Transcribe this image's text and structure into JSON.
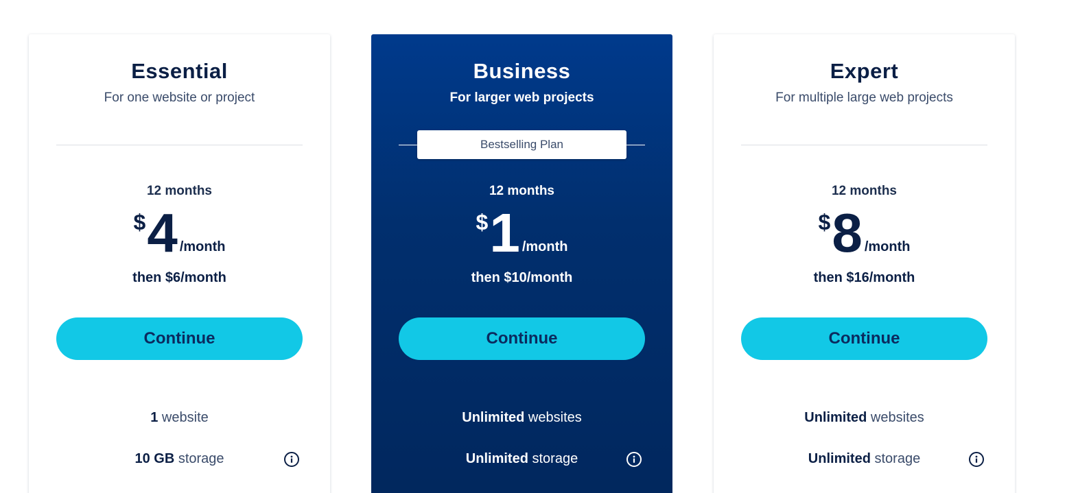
{
  "plans": [
    {
      "name": "Essential",
      "subtitle": "For one website or project",
      "term": "12 months",
      "currency": "$",
      "price": "4",
      "per": "/month",
      "then": "then $6/month",
      "cta": "Continue",
      "feature1": {
        "bold": "1",
        "rest": " website"
      },
      "feature2": {
        "bold": "10 GB",
        "rest": " storage"
      }
    },
    {
      "name": "Business",
      "subtitle": "For larger web projects",
      "badge": "Bestselling Plan",
      "term": "12 months",
      "currency": "$",
      "price": "1",
      "per": "/month",
      "then": "then $10/month",
      "cta": "Continue",
      "feature1": {
        "bold": "Unlimited",
        "rest": " websites"
      },
      "feature2": {
        "bold": "Unlimited",
        "rest": " storage"
      }
    },
    {
      "name": "Expert",
      "subtitle": "For multiple large web projects",
      "term": "12 months",
      "currency": "$",
      "price": "8",
      "per": "/month",
      "then": "then $16/month",
      "cta": "Continue",
      "feature1": {
        "bold": "Unlimited",
        "rest": " websites"
      },
      "feature2": {
        "bold": "Unlimited",
        "rest": " storage"
      }
    }
  ],
  "colors": {
    "navy_text": "#0b1f45",
    "business_card_top": "#003a8c",
    "business_card_bottom": "#01275d",
    "cta_background": "#12c8e6",
    "cta_text": "#0b2a5e"
  },
  "icons": {
    "info": "info-circle-icon"
  }
}
